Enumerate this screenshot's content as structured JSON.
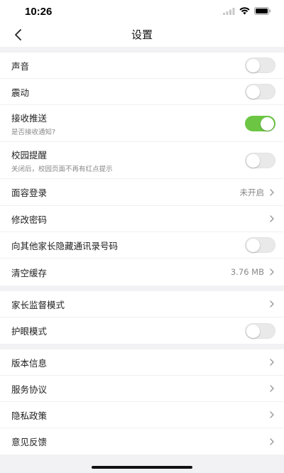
{
  "status_bar": {
    "time": "10:26"
  },
  "nav": {
    "title": "设置"
  },
  "groups": [
    {
      "rows": [
        {
          "label": "声音",
          "control": "toggle",
          "on": false
        },
        {
          "label": "震动",
          "control": "toggle",
          "on": false
        },
        {
          "label": "接收推送",
          "sub": "是否接收通知?",
          "control": "toggle",
          "on": true
        },
        {
          "label": "校园提醒",
          "sub": "关闭后，校园页面不再有红点提示",
          "control": "toggle",
          "on": false
        },
        {
          "label": "面容登录",
          "value": "未开启",
          "control": "chevron"
        },
        {
          "label": "修改密码",
          "control": "chevron"
        },
        {
          "label": "向其他家长隐藏通讯录号码",
          "control": "toggle",
          "on": false
        },
        {
          "label": "清空缓存",
          "value": "3.76 MB",
          "control": "chevron"
        }
      ]
    },
    {
      "rows": [
        {
          "label": "家长监督模式",
          "control": "chevron"
        },
        {
          "label": "护眼模式",
          "control": "toggle",
          "on": false
        }
      ]
    },
    {
      "rows": [
        {
          "label": "版本信息",
          "control": "chevron"
        },
        {
          "label": "服务协议",
          "control": "chevron"
        },
        {
          "label": "隐私政策",
          "control": "chevron"
        },
        {
          "label": "意见反馈",
          "control": "chevron"
        }
      ]
    }
  ],
  "colors": {
    "toggle_on": "#6cc644",
    "toggle_off": "#e9e9ea",
    "background": "#f2f2f4"
  }
}
